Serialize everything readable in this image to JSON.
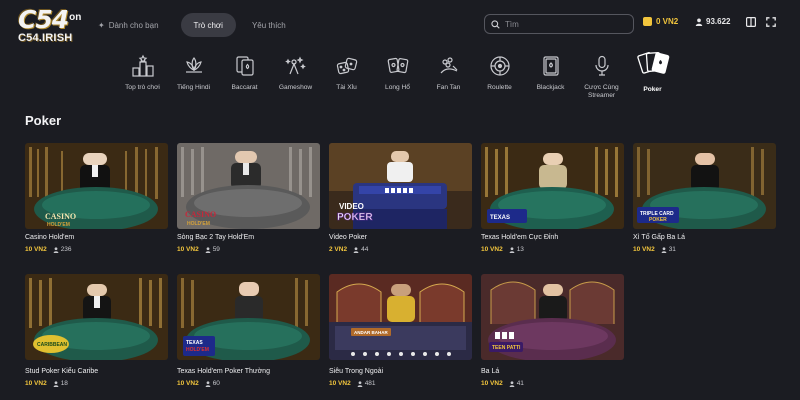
{
  "brand": {
    "name": "C54",
    "on": "on",
    "domain": "C54.IRISH"
  },
  "nav": {
    "items": [
      {
        "label": "Dành cho bạn",
        "icon": "sparkle-icon",
        "active": false
      },
      {
        "label": "Trò chơi",
        "active": true
      },
      {
        "label": "Yêu thích",
        "active": false
      }
    ]
  },
  "search": {
    "placeholder": "Tìm",
    "value": ""
  },
  "balance": {
    "value": "0 VN2"
  },
  "online": {
    "count": "93.622"
  },
  "categories": [
    {
      "label": "Top trò chơi",
      "icon": "podium-icon"
    },
    {
      "label": "Tiếng Hindi",
      "icon": "lotus-icon"
    },
    {
      "label": "Baccarat",
      "icon": "baccarat-icon"
    },
    {
      "label": "Gameshow",
      "icon": "gameshow-icon"
    },
    {
      "label": "Tài Xỉu",
      "icon": "dice-icon"
    },
    {
      "label": "Long Hổ",
      "icon": "dragon-tiger-icon"
    },
    {
      "label": "Fan Tan",
      "icon": "fan-tan-icon"
    },
    {
      "label": "Roulette",
      "icon": "roulette-icon"
    },
    {
      "label": "Blackjack",
      "icon": "blackjack-icon"
    },
    {
      "label": "Cược Cùng Streamer",
      "icon": "microphone-icon"
    },
    {
      "label": "Poker",
      "icon": "poker-cards-icon",
      "active": true
    }
  ],
  "section": {
    "title": "Poker"
  },
  "games": [
    {
      "title": "Casino Hold'em",
      "price": "10 VN2",
      "players": "236",
      "badge": "CASINO HOLD'EM"
    },
    {
      "title": "Sòng Bạc 2 Tay Hold'Em",
      "price": "10 VN2",
      "players": "59",
      "badge": "2 HAND CASINO HOLD'EM"
    },
    {
      "title": "Video Poker",
      "price": "2 VN2",
      "players": "44",
      "badge": "VIDEO POKER"
    },
    {
      "title": "Texas Hold'em Cực Đỉnh",
      "price": "10 VN2",
      "players": "13",
      "badge": "ULTIMATE TEXAS HOLD'EM"
    },
    {
      "title": "Xì Tố Gấp Ba Lá",
      "price": "10 VN2",
      "players": "31",
      "badge": "TRIPLE CARD POKER"
    },
    {
      "title": "Stud Poker Kiểu Caribe",
      "price": "10 VN2",
      "players": "18",
      "badge": "CARIBBEAN STUD POKER"
    },
    {
      "title": "Texas Hold'em Poker Thường",
      "price": "10 VN2",
      "players": "60",
      "badge": "TEXAS HOLD'EM BONUS POKER"
    },
    {
      "title": "Siêu Trong Ngoài",
      "price": "10 VN2",
      "players": "481",
      "badge": "SUPER ANDAR BAHAR"
    },
    {
      "title": "Ba Lá",
      "price": "10 VN2",
      "players": "41",
      "badge": "TEEN PATTI"
    }
  ],
  "colors": {
    "background": "#1b1c22",
    "accent": "#f2c53d",
    "table_green": "#1f5a4a",
    "table_blue": "#2a3580",
    "table_purple": "#5a2d4e"
  }
}
